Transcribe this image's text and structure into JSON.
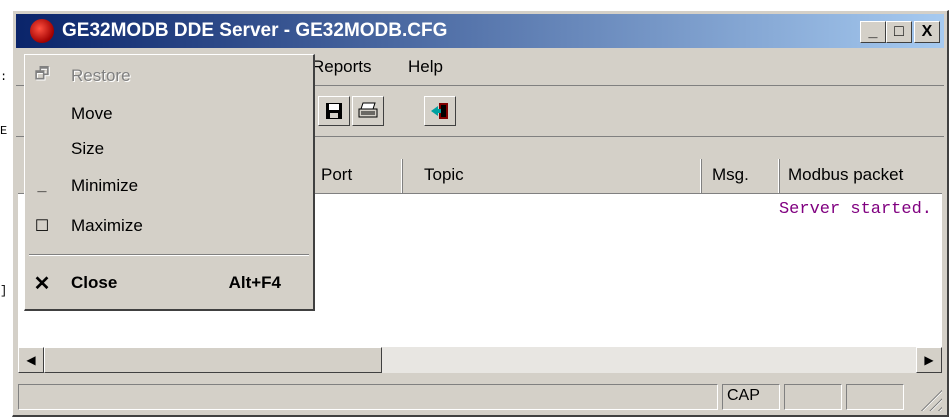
{
  "window": {
    "title": "GE32MODB DDE Server - GE32MODB.CFG",
    "buttons": {
      "minimize": "_",
      "maximize": "□",
      "close": "X"
    }
  },
  "menubar": {
    "items": [
      {
        "label": "Reports"
      },
      {
        "label": "Help"
      }
    ]
  },
  "toolbar": {
    "icons": [
      "save-icon",
      "print-icon",
      "exit-icon"
    ]
  },
  "columns": {
    "port": "Port",
    "topic": "Topic",
    "msg": "Msg.",
    "modbus": "Modbus packet"
  },
  "log": {
    "line1": "Server started."
  },
  "statusbar": {
    "cap": "CAP"
  },
  "system_menu": {
    "items": [
      {
        "label": "Restore",
        "icon": "restore-icon",
        "enabled": false
      },
      {
        "label": "Move",
        "enabled": true
      },
      {
        "label": "Size",
        "enabled": true
      },
      {
        "label": "Minimize",
        "icon": "minimize-icon",
        "enabled": true
      },
      {
        "label": "Maximize",
        "icon": "maximize-icon",
        "enabled": true
      },
      {
        "label": "Close",
        "accelerator": "Alt+F4",
        "icon": "close-icon",
        "enabled": true,
        "bold": true
      }
    ]
  }
}
